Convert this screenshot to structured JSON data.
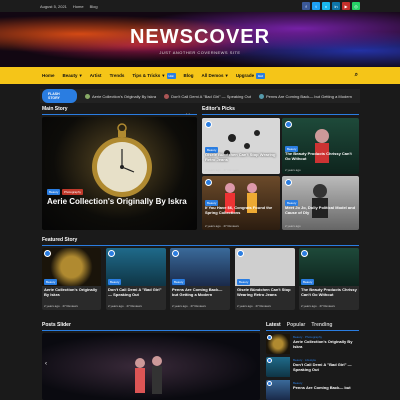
{
  "topbar": {
    "date": "August 5, 2021",
    "links": [
      "Home",
      "Blog"
    ]
  },
  "social": [
    "f",
    "t",
    "v",
    "in",
    "▶",
    "◎"
  ],
  "brand": {
    "name": "NEWSCOVER",
    "tagline": "JUST ANOTHER COVERNEWS SITE"
  },
  "nav": {
    "items": [
      {
        "label": "Home",
        "badge": ""
      },
      {
        "label": "Beauty",
        "badge": ""
      },
      {
        "label": "Artist",
        "badge": ""
      },
      {
        "label": "Trends",
        "badge": ""
      },
      {
        "label": "Tips & Tricks",
        "badge": "Hot"
      },
      {
        "label": "Blog",
        "badge": ""
      },
      {
        "label": "All Demos",
        "badge": ""
      },
      {
        "label": "Upgrade",
        "badge": "Hot"
      }
    ]
  },
  "ticker": {
    "flash": "FLASH STORY",
    "items": [
      "Aerie Collection's Originally By Iskra",
      "Don't Call Demi A \"Bad Girl\" — Speaking Out",
      "Penns Are Coming Back— but Getting a Modern"
    ]
  },
  "main_story": {
    "title": "Main Story",
    "headline": "Aerie Collection's Originally By Iskra",
    "cats": [
      "Beauty",
      "Photography"
    ]
  },
  "editors": {
    "title": "Editor's Picks",
    "items": [
      {
        "title": "Gisele Bündchen Can't Stop Wearing Retro Jeans",
        "cat": "Beauty",
        "meta": "2 years ago · 47 Reviews"
      },
      {
        "title": "The Beauty Products Chrissy Can't Go Without",
        "cat": "Beauty",
        "meta": "2 years ago"
      },
      {
        "title": "If You Have $6, Congrats Found the Spring Collections",
        "cat": "Beauty",
        "meta": "2 years ago · 47 Reviews"
      },
      {
        "title": "Meet Jo Jo, Dolly Political Model and Cause of Dly",
        "cat": "Beauty",
        "meta": "2 years ago"
      }
    ]
  },
  "featured": {
    "title": "Featured Story",
    "items": [
      {
        "title": "Aerie Collection's Originally By Iskra",
        "cat": "Beauty"
      },
      {
        "title": "Don't Call Demi A \"Bad Girl\" — Speaking Out",
        "cat": "Beauty"
      },
      {
        "title": "Penns Are Coming Back— but Getting a Modern",
        "cat": "Beauty"
      },
      {
        "title": "Gisele Bündchen Can't Stop Wearing Retro Jeans",
        "cat": "Beauty"
      },
      {
        "title": "The Beauty Products Chrissy Can't Go Without",
        "cat": "Beauty"
      }
    ],
    "meta": "2 years ago · 47 Reviews"
  },
  "posts_slider": {
    "title": "Posts Slider"
  },
  "latest": {
    "tabs": [
      "Latest",
      "Popular",
      "Trending"
    ],
    "items": [
      {
        "title": "Aerie Collection's Originally By Iskra",
        "cat": "Beauty · Photography"
      },
      {
        "title": "Don't Call Demi A \"Bad Girl\" — Speaking Out",
        "cat": "Beauty · Lifestyle"
      },
      {
        "title": "Penns Are Coming Back— but",
        "cat": "Beauty"
      }
    ]
  },
  "colors": {
    "accent": "#2a7de1",
    "nav": "#f5c518",
    "bg": "#1a1a1a"
  }
}
